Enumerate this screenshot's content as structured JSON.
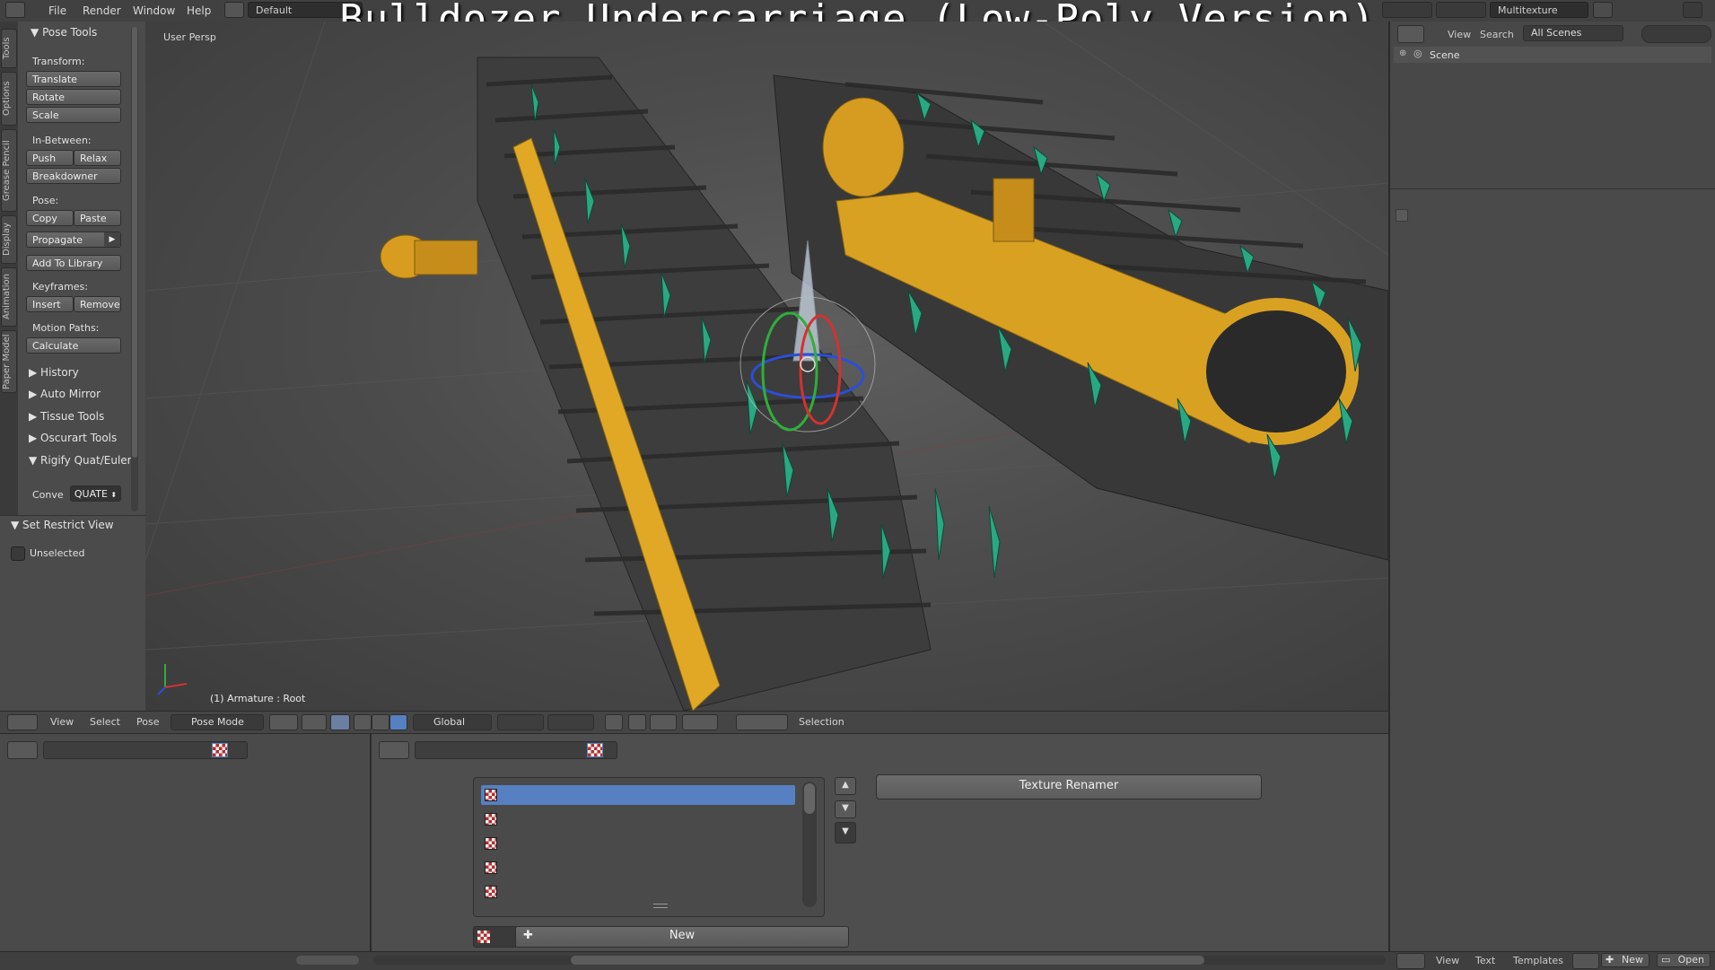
{
  "overlay_title": "Bulldozer Undercarriage (Low-Poly Version)",
  "menu": {
    "items": [
      "File",
      "Render",
      "Window",
      "Help"
    ],
    "layout": "Default",
    "engine": "Multitexture"
  },
  "vertical_tabs": [
    "Tools",
    "Options",
    "Grease Pencil",
    "Display",
    "Animation",
    "Paper Model"
  ],
  "toolshelf": {
    "panel_title": "Pose Tools",
    "transform_label": "Transform:",
    "translate": "Translate",
    "rotate": "Rotate",
    "scale": "Scale",
    "inbetween_label": "In-Between:",
    "push": "Push",
    "relax": "Relax",
    "breakdowner": "Breakdowner",
    "pose_label": "Pose:",
    "copy": "Copy",
    "paste": "Paste",
    "propagate": "Propagate",
    "add_to_library": "Add To Library",
    "keyframes_label": "Keyframes:",
    "insert": "Insert",
    "remove": "Remove",
    "motion_paths_label": "Motion Paths:",
    "calculate": "Calculate",
    "history": "History",
    "auto_mirror": "Auto Mirror",
    "tissue_tools": "Tissue Tools",
    "oscurart_tools": "Oscurart Tools",
    "rigify": "Rigify Quat/Euler",
    "convert_label": "Conve",
    "convert_value": "QUATE"
  },
  "restrict": {
    "title": "Set Restrict View",
    "unselected": "Unselected"
  },
  "viewport": {
    "view_label": "User Persp",
    "object_info": "(1) Armature : Root"
  },
  "vp_header": {
    "view": "View",
    "select": "Select",
    "pose": "Pose",
    "mode": "Pose Mode",
    "orientation": "Global",
    "selection": "Selection"
  },
  "texture_panel": {
    "renamer_button": "Texture Renamer",
    "new_button": "New",
    "slot_count": 5
  },
  "outliner": {
    "view": "View",
    "search": "Search",
    "scenes": "All Scenes",
    "scene_item": "Scene"
  },
  "text_editor": {
    "view": "View",
    "text": "Text",
    "templates": "Templates",
    "new": "New",
    "open": "Open"
  },
  "colors": {
    "selection_blue": "#5680c2",
    "track_yellow": "#e0a825",
    "bone_green": "#2aa882"
  }
}
